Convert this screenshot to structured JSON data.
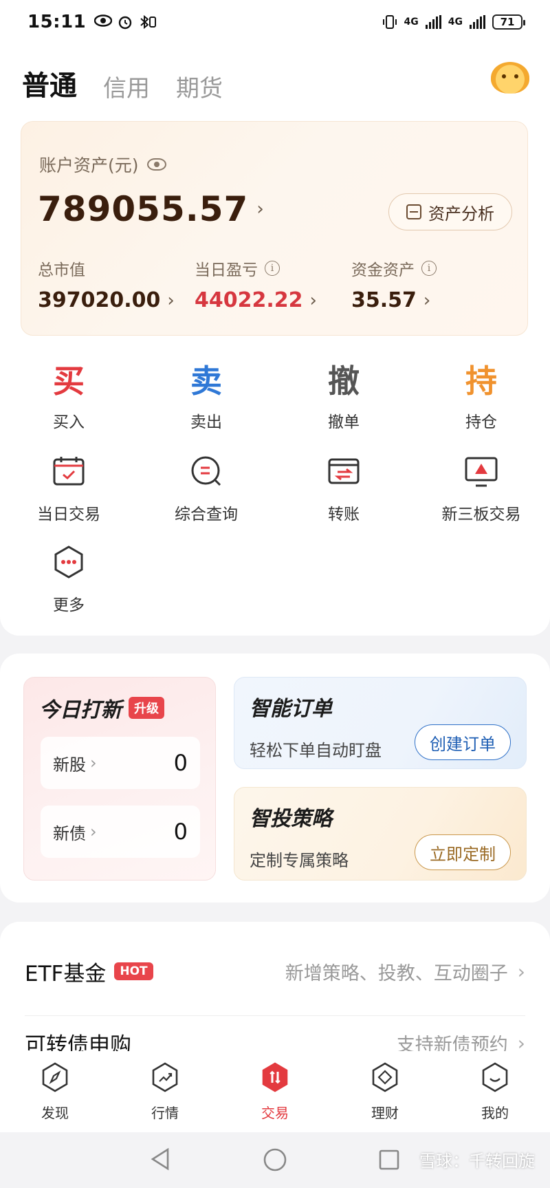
{
  "status_bar": {
    "time": "15:11",
    "left_icons": [
      "eye-icon",
      "alarm-icon",
      "bluetooth-icon"
    ],
    "network_1": "4G",
    "network_2": "4G",
    "battery": "71"
  },
  "header": {
    "tabs": [
      {
        "label": "普通",
        "active": true
      },
      {
        "label": "信用",
        "active": false
      },
      {
        "label": "期货",
        "active": false
      }
    ]
  },
  "account": {
    "label": "账户资产(元)",
    "total": "789055.57",
    "analysis_button": "资产分析",
    "stats": [
      {
        "label": "总市值",
        "value": "397020.00"
      },
      {
        "label": "当日盈亏",
        "value": "44022.22",
        "color": "#d6373f"
      },
      {
        "label": "资金资产",
        "value": "35.57"
      }
    ]
  },
  "actions": {
    "primary": [
      {
        "glyph": "买",
        "label": "买入",
        "color": "#e33a3f"
      },
      {
        "glyph": "卖",
        "label": "卖出",
        "color": "#2f78d6"
      },
      {
        "glyph": "撤",
        "label": "撤单",
        "color": "#555555"
      },
      {
        "glyph": "持",
        "label": "持仓",
        "color": "#f0922e"
      }
    ],
    "secondary": [
      {
        "label": "当日交易",
        "icon": "calendar-check-icon"
      },
      {
        "label": "综合查询",
        "icon": "search-query-icon"
      },
      {
        "label": "转账",
        "icon": "transfer-icon"
      },
      {
        "label": "新三板交易",
        "icon": "monitor-icon"
      },
      {
        "label": "更多",
        "icon": "more-icon"
      }
    ]
  },
  "promo": {
    "ipo": {
      "title": "今日打新",
      "badge": "升级",
      "rows": [
        {
          "label": "新股",
          "value": "0"
        },
        {
          "label": "新债",
          "value": "0"
        }
      ]
    },
    "smart_order": {
      "title": "智能订单",
      "subtitle": "轻松下单自动盯盘",
      "button": "创建订单"
    },
    "strategy": {
      "title": "智投策略",
      "subtitle": "定制专属策略",
      "button": "立即定制"
    }
  },
  "list": [
    {
      "title": "ETF基金",
      "badge": "HOT",
      "desc": "新增策略、投教、互动圈子"
    },
    {
      "title": "可转债申购",
      "badge": "",
      "desc": "支持新债预约"
    }
  ],
  "bottom_nav": [
    {
      "label": "发现",
      "active": false
    },
    {
      "label": "行情",
      "active": false
    },
    {
      "label": "交易",
      "active": true
    },
    {
      "label": "理财",
      "active": false
    },
    {
      "label": "我的",
      "active": false
    }
  ],
  "watermark": "雪球：千转回旋",
  "colors": {
    "accent_red": "#e33a3f",
    "accent_blue": "#2f78d6",
    "accent_orange": "#f0922e",
    "asset_brown": "#3a1e0d"
  }
}
